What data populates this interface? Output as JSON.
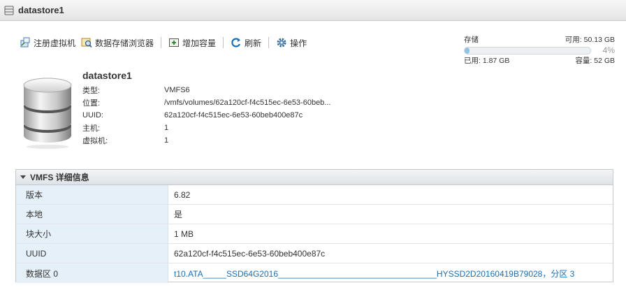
{
  "window": {
    "title": "datastore1"
  },
  "toolbar": {
    "register_vm": "注册虚拟机",
    "datastore_browser": "数据存储浏览器",
    "increase_capacity": "增加容量",
    "refresh": "刷新",
    "actions": "操作"
  },
  "storage": {
    "label": "存储",
    "free": "可用: 50.13 GB",
    "percent_text": "4%",
    "percent_used": 4,
    "used": "已用: 1.87 GB",
    "capacity": "容量: 52 GB"
  },
  "datastore": {
    "name": "datastore1",
    "fields": [
      {
        "label": "类型:",
        "value": "VMFS6"
      },
      {
        "label": "位置:",
        "value": "/vmfs/volumes/62a120cf-f4c515ec-6e53-60beb..."
      },
      {
        "label": "UUID:",
        "value": "62a120cf-f4c515ec-6e53-60beb400e87c"
      },
      {
        "label": "主机:",
        "value": "1"
      },
      {
        "label": "虚拟机:",
        "value": "1"
      }
    ]
  },
  "vmfs": {
    "title": "VMFS 详细信息",
    "rows": [
      {
        "key": "版本",
        "value": "6.82"
      },
      {
        "key": "本地",
        "value": "是"
      },
      {
        "key": "块大小",
        "value": "1 MB"
      },
      {
        "key": "UUID",
        "value": "62a120cf-f4c515ec-6e53-60beb400e87c"
      },
      {
        "key": "数据区 0",
        "value": "t10.ATA_____SSD64G2016__________________________________HYSSD2D20160419B79028，分区 3"
      }
    ]
  },
  "colors": {
    "accent": "#1a6fb5",
    "bar_fill": "#8fc4e6",
    "key_bg": "#e6f0f8"
  }
}
